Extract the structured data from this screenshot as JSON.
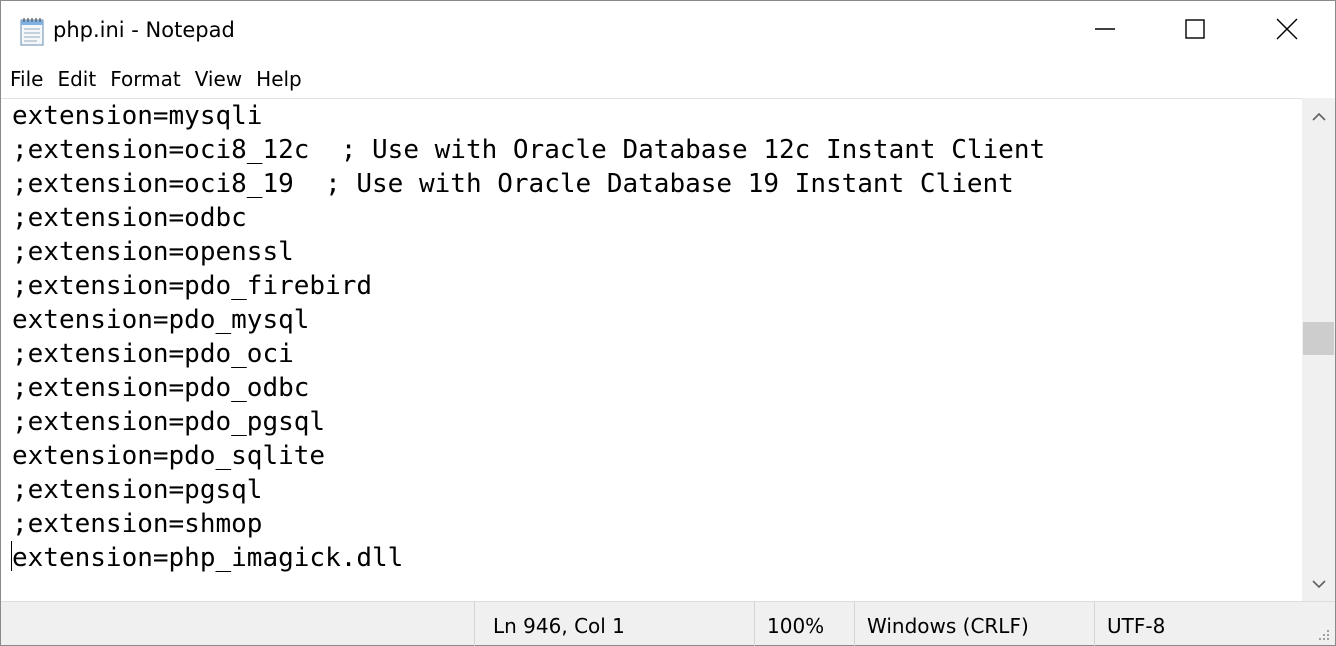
{
  "window": {
    "title": "php.ini - Notepad",
    "app_icon": "notepad-icon"
  },
  "controls": {
    "minimize_icon": "minimize-icon",
    "maximize_icon": "maximize-icon",
    "close_icon": "close-icon"
  },
  "menu": {
    "items": [
      {
        "label": "File"
      },
      {
        "label": "Edit"
      },
      {
        "label": "Format"
      },
      {
        "label": "View"
      },
      {
        "label": "Help"
      }
    ]
  },
  "editor": {
    "lines": [
      "extension=mysqli",
      ";extension=oci8_12c  ; Use with Oracle Database 12c Instant Client",
      ";extension=oci8_19  ; Use with Oracle Database 19 Instant Client",
      ";extension=odbc",
      ";extension=openssl",
      ";extension=pdo_firebird",
      "extension=pdo_mysql",
      ";extension=pdo_oci",
      ";extension=pdo_odbc",
      ";extension=pdo_pgsql",
      "extension=pdo_sqlite",
      ";extension=pgsql",
      ";extension=shmop",
      "extension=php_imagick.dll"
    ]
  },
  "statusbar": {
    "position": "Ln 946, Col 1",
    "zoom": "100%",
    "line_endings": "Windows (CRLF)",
    "encoding": "UTF-8"
  },
  "colors": {
    "statusbar_bg": "#f0f0f0",
    "scroll_thumb": "#cdcdcd"
  }
}
